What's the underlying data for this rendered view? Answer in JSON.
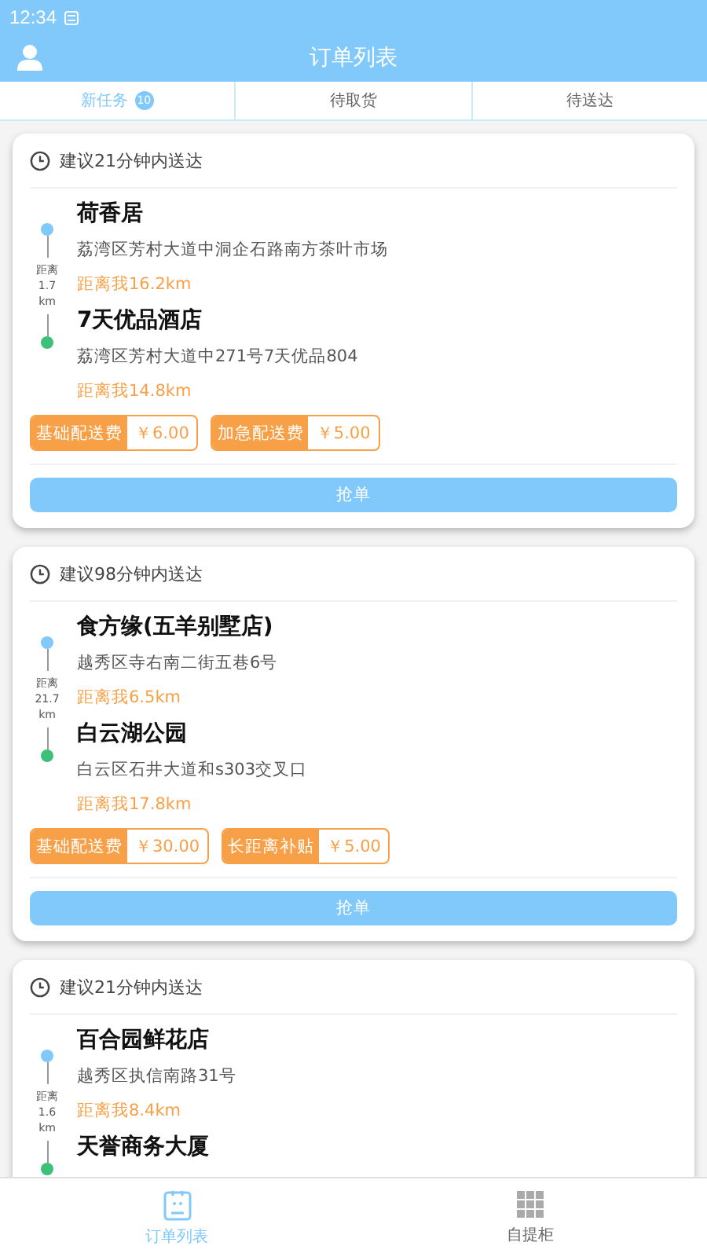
{
  "status_bar": {
    "time": "12:34"
  },
  "header": {
    "title": "订单列表"
  },
  "tabs": [
    {
      "label": "新任务",
      "badge": "10",
      "selected": true
    },
    {
      "label": "待取货",
      "selected": false
    },
    {
      "label": "待送达",
      "selected": false
    }
  ],
  "orders": [
    {
      "suggestion": "建议21分钟内送达",
      "segment_distance": "距离 1.7 km",
      "pickup": {
        "name": "荷香居",
        "address": "荔湾区芳村大道中洞企石路南方茶叶市场",
        "distance": "距离我16.2km"
      },
      "dropoff": {
        "name": "7天优品酒店",
        "address": "荔湾区芳村大道中271号7天优品804",
        "distance": "距离我14.8km"
      },
      "fees": [
        {
          "label": "基础配送费",
          "amount": "￥6.00"
        },
        {
          "label": "加急配送费",
          "amount": "￥5.00"
        }
      ],
      "action": "抢单"
    },
    {
      "suggestion": "建议98分钟内送达",
      "segment_distance": "距离 21.7 km",
      "pickup": {
        "name": "食方缘(五羊别墅店)",
        "address": "越秀区寺右南二街五巷6号",
        "distance": "距离我6.5km"
      },
      "dropoff": {
        "name": "白云湖公园",
        "address": "白云区石井大道和s303交叉口",
        "distance": "距离我17.8km"
      },
      "fees": [
        {
          "label": "基础配送费",
          "amount": "￥30.00"
        },
        {
          "label": "长距离补贴",
          "amount": "￥5.00"
        }
      ],
      "action": "抢单"
    },
    {
      "suggestion": "建议21分钟内送达",
      "segment_distance": "距离 1.6 km",
      "pickup": {
        "name": "百合园鲜花店",
        "address": "越秀区执信南路31号",
        "distance": "距离我8.4km"
      },
      "dropoff": {
        "name": "天誉商务大厦"
      }
    }
  ],
  "bottom_nav": [
    {
      "label": "订单列表",
      "selected": true
    },
    {
      "label": "自提柜",
      "selected": false
    }
  ]
}
